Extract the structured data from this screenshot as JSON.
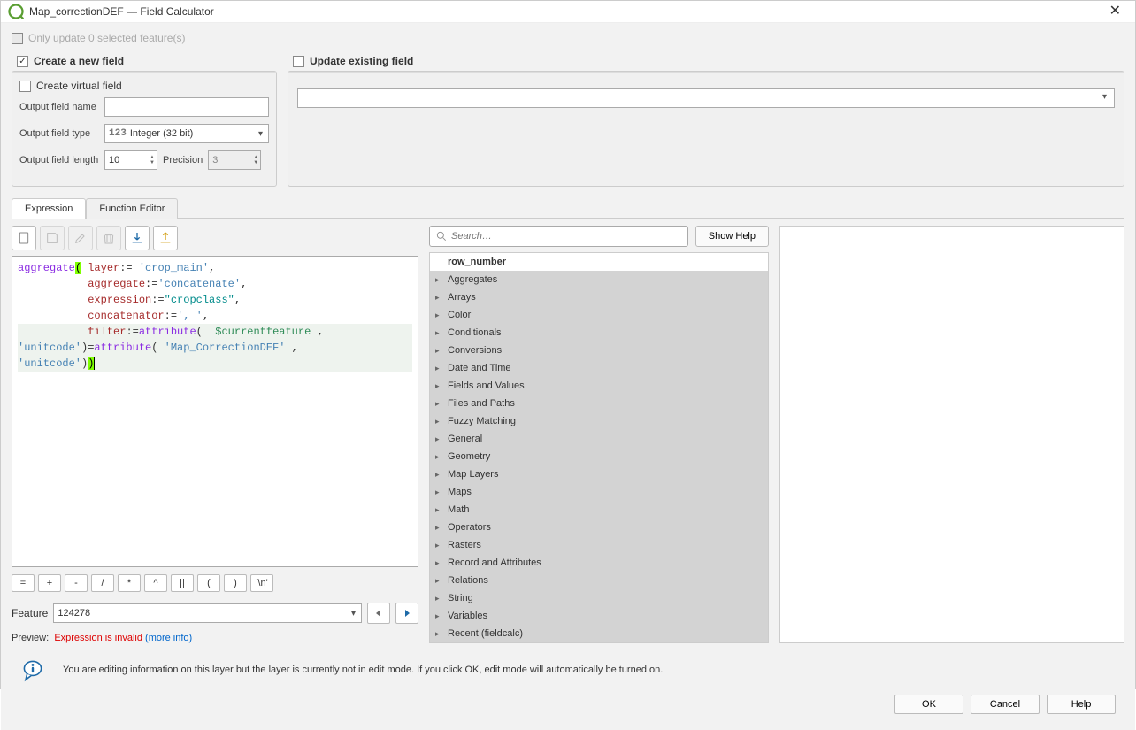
{
  "window": {
    "title": "Map_correctionDEF — Field Calculator"
  },
  "checkboxes": {
    "only_update_label": "Only update 0 selected feature(s)",
    "create_new_field_label": "Create a new field",
    "create_virtual_field_label": "Create virtual field",
    "update_existing_label": "Update existing field"
  },
  "form": {
    "output_field_name_label": "Output field name",
    "output_field_name_value": "",
    "output_field_type_label": "Output field type",
    "output_field_type_value": "Integer (32 bit)",
    "type_prefix": "123",
    "output_field_length_label": "Output field length",
    "output_field_length_value": "10",
    "precision_label": "Precision",
    "precision_value": "3"
  },
  "tabs": {
    "expression": "Expression",
    "function_editor": "Function Editor"
  },
  "expression_tokens": [
    {
      "t": "fn",
      "v": "aggregate"
    },
    {
      "t": "paren",
      "v": "("
    },
    {
      "t": "txt",
      "v": " "
    },
    {
      "t": "kw",
      "v": "layer"
    },
    {
      "t": "txt",
      "v": ":= "
    },
    {
      "t": "str",
      "v": "'crop_main'"
    },
    {
      "t": "txt",
      "v": ",\n           "
    },
    {
      "t": "kw",
      "v": "aggregate"
    },
    {
      "t": "txt",
      "v": ":="
    },
    {
      "t": "str",
      "v": "'concatenate'"
    },
    {
      "t": "txt",
      "v": ",\n           "
    },
    {
      "t": "kw",
      "v": "expression"
    },
    {
      "t": "txt",
      "v": ":="
    },
    {
      "t": "id",
      "v": "\"cropclass\""
    },
    {
      "t": "txt",
      "v": ",\n           "
    },
    {
      "t": "kw",
      "v": "concatenator"
    },
    {
      "t": "txt",
      "v": ":="
    },
    {
      "t": "str",
      "v": "', '"
    },
    {
      "t": "txt",
      "v": ",\n"
    },
    {
      "t": "hl-start",
      "v": ""
    },
    {
      "t": "txt",
      "v": "           "
    },
    {
      "t": "kw",
      "v": "filter"
    },
    {
      "t": "txt",
      "v": ":="
    },
    {
      "t": "fn",
      "v": "attribute"
    },
    {
      "t": "txt",
      "v": "(  "
    },
    {
      "t": "var",
      "v": "$currentfeature"
    },
    {
      "t": "txt",
      "v": " , "
    },
    {
      "t": "hl-end",
      "v": ""
    },
    {
      "t": "hl-start",
      "v": ""
    },
    {
      "t": "str",
      "v": "'unitcode'"
    },
    {
      "t": "txt",
      "v": ")="
    },
    {
      "t": "fn",
      "v": "attribute"
    },
    {
      "t": "txt",
      "v": "( "
    },
    {
      "t": "str",
      "v": "'Map_CorrectionDEF'"
    },
    {
      "t": "txt",
      "v": " , "
    },
    {
      "t": "hl-end",
      "v": ""
    },
    {
      "t": "hl-start",
      "v": ""
    },
    {
      "t": "str",
      "v": "'unitcode'"
    },
    {
      "t": "txt",
      "v": ")"
    },
    {
      "t": "paren",
      "v": ")"
    },
    {
      "t": "cursor",
      "v": ""
    },
    {
      "t": "hl-end",
      "v": ""
    }
  ],
  "operators": [
    "=",
    "+",
    "-",
    "/",
    "*",
    "^",
    "||",
    "(",
    ")",
    "'\\n'"
  ],
  "feature": {
    "label": "Feature",
    "value": "124278"
  },
  "preview": {
    "label": "Preview:",
    "error": "Expression is invalid",
    "more": "(more info)"
  },
  "search": {
    "placeholder": "Search…"
  },
  "show_help_label": "Show Help",
  "functions_header": "row_number",
  "function_categories": [
    "Aggregates",
    "Arrays",
    "Color",
    "Conditionals",
    "Conversions",
    "Date and Time",
    "Fields and Values",
    "Files and Paths",
    "Fuzzy Matching",
    "General",
    "Geometry",
    "Map Layers",
    "Maps",
    "Math",
    "Operators",
    "Rasters",
    "Record and Attributes",
    "Relations",
    "String",
    "Variables",
    "Recent (fieldcalc)"
  ],
  "footer_info": "You are editing information on this layer but the layer is currently not in edit mode. If you click OK, edit mode will automatically be turned on.",
  "buttons": {
    "ok": "OK",
    "cancel": "Cancel",
    "help": "Help"
  }
}
